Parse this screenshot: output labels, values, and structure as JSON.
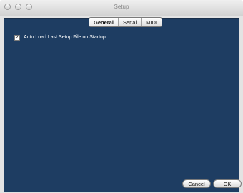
{
  "window": {
    "title": "Setup"
  },
  "tabs": [
    {
      "label": "General",
      "selected": true
    },
    {
      "label": "Serial",
      "selected": false
    },
    {
      "label": "MIDI",
      "selected": false
    }
  ],
  "general": {
    "auto_load_label": "Auto Load Last Setup File on Startup",
    "auto_load_checked": true,
    "check_glyph": "✓"
  },
  "buttons": {
    "cancel": "Cancel",
    "ok": "OK"
  },
  "colors": {
    "panel_bg": "#1e3d62",
    "window_bg": "#e3e3e3"
  }
}
